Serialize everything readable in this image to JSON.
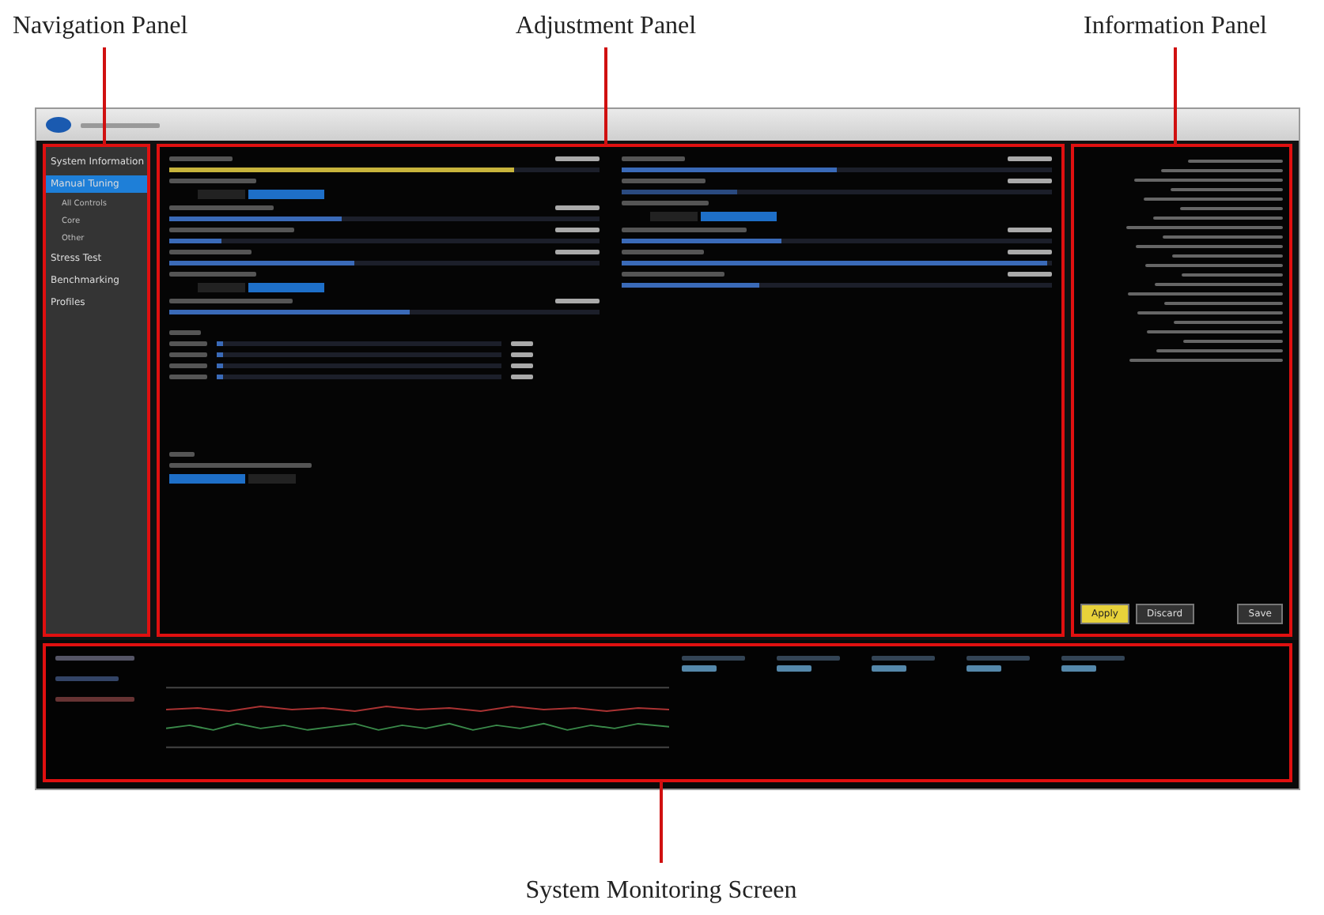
{
  "annotations": [
    {
      "label": "Navigation Panel"
    },
    {
      "label": "Adjustment Panel"
    },
    {
      "label": "Information Panel"
    },
    {
      "label": "System Monitoring Screen"
    }
  ],
  "navigation": {
    "items": [
      {
        "label": "System Information",
        "selected": false
      },
      {
        "label": "Manual Tuning",
        "selected": true,
        "children": [
          {
            "label": "All Controls"
          },
          {
            "label": "Core"
          },
          {
            "label": "Other"
          }
        ]
      },
      {
        "label": "Stress Test",
        "selected": false
      },
      {
        "label": "Benchmarking",
        "selected": false
      },
      {
        "label": "Profiles",
        "selected": false
      }
    ]
  },
  "adjustment": {
    "columns": [
      [
        {
          "kind": "slider",
          "level": 0.8,
          "color": "#c8b43c"
        },
        {
          "kind": "toggle",
          "options": [
            {
              "selected": false
            },
            {
              "selected": true
            }
          ]
        },
        {
          "kind": "slider",
          "level": 0.4,
          "color": "#3a6ab8"
        },
        {
          "kind": "slider",
          "level": 0.12,
          "color": "#3a6ab8"
        },
        {
          "kind": "slider",
          "level": 0.43,
          "color": "#3a6ab8"
        },
        {
          "kind": "toggle",
          "options": [
            {
              "selected": false
            },
            {
              "selected": true
            }
          ]
        },
        {
          "kind": "slider",
          "level": 0.56,
          "color": "#3a6ab8"
        }
      ],
      [
        {
          "kind": "slider",
          "level": 0.5,
          "color": "#3a6ab8"
        },
        {
          "kind": "slider",
          "level": 0.27,
          "color": "#2a4a80"
        },
        {
          "kind": "toggle",
          "options": [
            {
              "selected": false
            },
            {
              "selected": true
            }
          ]
        },
        {
          "kind": "slider",
          "level": 0.37,
          "color": "#3a6ab8"
        },
        {
          "kind": "slider",
          "level": 0.99,
          "color": "#3a6ab8"
        },
        {
          "kind": "slider",
          "level": 0.32,
          "color": "#3a6ab8"
        }
      ]
    ],
    "ratio_sliders": [
      {
        "level": 0.02
      },
      {
        "level": 0.02
      },
      {
        "level": 0.02
      },
      {
        "level": 0.02
      }
    ],
    "other_toggle": {
      "options": [
        {
          "selected": true
        },
        {
          "selected": false
        }
      ]
    }
  },
  "information": {
    "buttons": [
      {
        "label": "Apply",
        "kind": "primary"
      },
      {
        "label": "Discard",
        "kind": "secondary"
      },
      {
        "label": "Save",
        "kind": "secondary"
      }
    ]
  }
}
